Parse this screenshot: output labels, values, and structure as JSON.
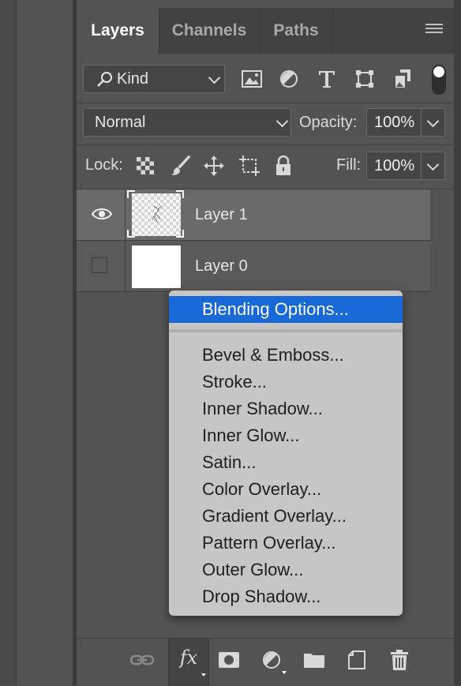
{
  "tabs": [
    {
      "label": "Layers",
      "active": true
    },
    {
      "label": "Channels",
      "active": false
    },
    {
      "label": "Paths",
      "active": false
    }
  ],
  "filter": {
    "kind_label": "Kind",
    "icons": [
      "image-filter-icon",
      "adjustment-filter-icon",
      "type-filter-icon",
      "shape-filter-icon",
      "smart-object-filter-icon"
    ]
  },
  "blend": {
    "mode": "Normal",
    "opacity_label": "Opacity:",
    "opacity_value": "100%"
  },
  "lock": {
    "label": "Lock:",
    "icons": [
      "lock-transparent-pixels-icon",
      "lock-image-pixels-icon",
      "lock-position-icon",
      "lock-artboard-icon",
      "lock-all-icon"
    ],
    "fill_label": "Fill:",
    "fill_value": "100%"
  },
  "layers": [
    {
      "name": "Layer 1",
      "visible": true,
      "selected": true
    },
    {
      "name": "Layer 0",
      "visible": false,
      "selected": false
    }
  ],
  "context_menu": {
    "highlighted": "Blending Options...",
    "items": [
      "Bevel & Emboss...",
      "Stroke...",
      "Inner Shadow...",
      "Inner Glow...",
      "Satin...",
      "Color Overlay...",
      "Gradient Overlay...",
      "Pattern Overlay...",
      "Outer Glow...",
      "Drop Shadow..."
    ]
  },
  "bottom_bar": {
    "fx_label": "fx",
    "icons": [
      "link-layers-icon",
      "add-layer-style-icon",
      "add-mask-icon",
      "new-adjustment-layer-icon",
      "new-group-icon",
      "new-layer-icon",
      "delete-layer-icon"
    ]
  },
  "colors": {
    "panel_bg": "#535353",
    "menu_bg": "#c6c6c6",
    "menu_highlight": "#1968d8",
    "selected_layer": "#6a6a6a"
  }
}
